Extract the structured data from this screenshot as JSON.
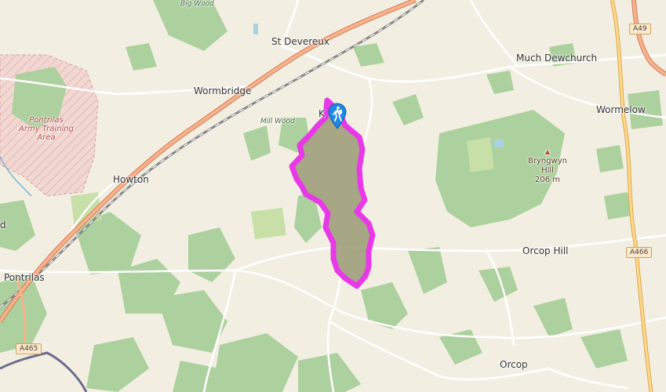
{
  "map": {
    "places": {
      "st_devereux": "St Devereux",
      "much_dewchurch": "Much Dewchurch",
      "wormbridge": "Wormbridge",
      "wormelow": "Wormelow",
      "mill_wood": "Mill Wood",
      "kilpeck": "K",
      "howton": "Howton",
      "pontrilas": "Pontrilas",
      "orcop_hill": "Orcop Hill",
      "orcop": "Orcop",
      "edge_d": "d",
      "big_wood_partial": "Big Wood"
    },
    "area_label": [
      "Pontrilas",
      "Army Training",
      "Area"
    ],
    "peak": {
      "name": [
        "Bryngwyn",
        "Hill"
      ],
      "elevation": "206 m"
    },
    "roads": {
      "a49": "A49",
      "a466": "A466",
      "a465": "A465"
    },
    "route_color": "#e838e8",
    "route_fill": "#9a9a74",
    "marker_icon": "hiker-icon",
    "marker_color": "#1e88e5"
  }
}
